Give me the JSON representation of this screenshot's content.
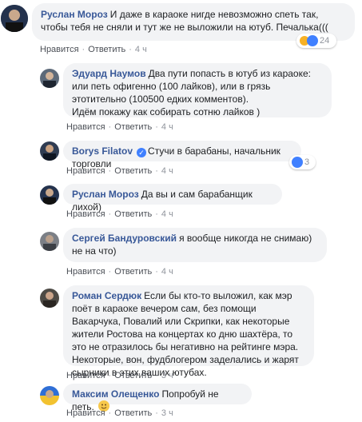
{
  "comments": [
    {
      "author": "Руслан Мороз",
      "text": "И даже в караоке нигде невозможно спеть так, чтобы тебя не сняли и тут же не выложили на ютуб. Печалька(((",
      "like": "Нравится",
      "reply": "Ответить",
      "time": "4 ч",
      "reactions": "24"
    },
    {
      "author": "Эдуард Наумов",
      "text": "Два пути попасть в ютуб из караоке: или петь офигенно (100 лайков), или в грязь этотительно (100500 едких комментов).",
      "text2": "Идём покажу как собирать сотню лайков )",
      "like": "Нравится",
      "reply": "Ответить",
      "time": "4 ч"
    },
    {
      "author": "Borys Filatov",
      "text": "Стучи в барабаны, начальник торговли",
      "like": "Нравится",
      "reply": "Ответить",
      "time": "4 ч",
      "reactions": "3"
    },
    {
      "author": "Руслан Мороз",
      "text": "Да вы и сам барабанщик лихой)",
      "like": "Нравится",
      "reply": "Ответить",
      "time": "4 ч"
    },
    {
      "author": "Сергей Бандуровский",
      "text": "я вообще никогда не снимаю) не на что)",
      "like": "Нравится",
      "reply": "Ответить",
      "time": "4 ч"
    },
    {
      "author": "Роман Сердюк",
      "text": "Если бы кто-то выложил, как мэр поёт в караоке вечером сам, без помощи Вакарчука, Повалий или Скрипки, как некоторые жители Ростова на концертах ко дню шахтёра, то это не отразилось бы негативно на рейтинге мэра. Некоторые, вон, фудблогером заделались и жарят сырники в этих ваших ютубах.",
      "like": "Нравится",
      "reply": "Ответить",
      "time": "3 ч"
    },
    {
      "author": "Максим Олещенко",
      "text": "Попробуй не петь.",
      "like": "Нравится",
      "reply": "Ответить",
      "time": "3 ч"
    }
  ],
  "colors": {
    "author": "#385898",
    "bubble": "#f2f3f5",
    "meta": "#90949c"
  }
}
